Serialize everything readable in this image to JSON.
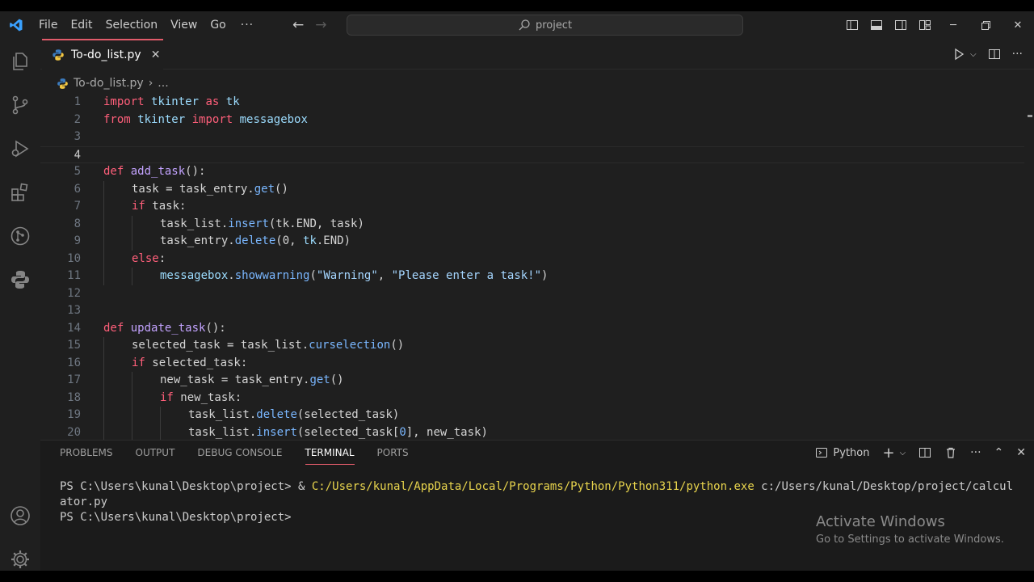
{
  "titlebar": {
    "menu": [
      "File",
      "Edit",
      "Selection",
      "View",
      "Go"
    ],
    "more": "···",
    "search_text": "project"
  },
  "activitybar": {
    "items": [
      "explorer-icon",
      "source-control-icon",
      "run-debug-icon",
      "extensions-icon",
      "git-graph-icon",
      "python-icon"
    ],
    "bottom": [
      "account-icon",
      "manage-gear-icon"
    ]
  },
  "editor": {
    "tab_label": "To-do_list.py",
    "breadcrumb_file": "To-do_list.py",
    "breadcrumb_more": "...",
    "active_line": 4,
    "lines": [
      {
        "n": "1",
        "indent": 0,
        "tokens": [
          [
            "kw",
            "import"
          ],
          [
            "pl",
            " "
          ],
          [
            "id",
            "tkinter"
          ],
          [
            "pl",
            " "
          ],
          [
            "kw",
            "as"
          ],
          [
            "pl",
            " "
          ],
          [
            "id",
            "tk"
          ]
        ]
      },
      {
        "n": "2",
        "indent": 0,
        "tokens": [
          [
            "kw",
            "from"
          ],
          [
            "pl",
            " "
          ],
          [
            "id",
            "tkinter"
          ],
          [
            "pl",
            " "
          ],
          [
            "kw",
            "import"
          ],
          [
            "pl",
            " "
          ],
          [
            "id",
            "messagebox"
          ]
        ]
      },
      {
        "n": "3",
        "indent": 0,
        "tokens": []
      },
      {
        "n": "4",
        "indent": 0,
        "tokens": []
      },
      {
        "n": "5",
        "indent": 0,
        "tokens": [
          [
            "kw",
            "def"
          ],
          [
            "pl",
            " "
          ],
          [
            "fn",
            "add_task"
          ],
          [
            "pl",
            "():"
          ]
        ]
      },
      {
        "n": "6",
        "indent": 1,
        "tokens": [
          [
            "pl",
            "task = task_entry."
          ],
          [
            "mt",
            "get"
          ],
          [
            "pl",
            "()"
          ]
        ]
      },
      {
        "n": "7",
        "indent": 1,
        "tokens": [
          [
            "kw",
            "if"
          ],
          [
            "pl",
            " task:"
          ]
        ]
      },
      {
        "n": "8",
        "indent": 2,
        "tokens": [
          [
            "pl",
            "task_list."
          ],
          [
            "mt",
            "insert"
          ],
          [
            "pl",
            "(tk.END, task)"
          ]
        ]
      },
      {
        "n": "9",
        "indent": 2,
        "tokens": [
          [
            "pl",
            "task_entry."
          ],
          [
            "mt",
            "delete"
          ],
          [
            "pl",
            "(0, "
          ],
          [
            "id",
            "tk"
          ],
          [
            "pl",
            ".END)"
          ]
        ]
      },
      {
        "n": "10",
        "indent": 1,
        "tokens": [
          [
            "kw",
            "else"
          ],
          [
            "pl",
            ":"
          ]
        ]
      },
      {
        "n": "11",
        "indent": 2,
        "tokens": [
          [
            "id",
            "messagebox"
          ],
          [
            "pl",
            "."
          ],
          [
            "mt",
            "showwarning"
          ],
          [
            "pl",
            "("
          ],
          [
            "str",
            "\"Warning\""
          ],
          [
            "pl",
            ", "
          ],
          [
            "str",
            "\"Please enter a task!\""
          ],
          [
            "pl",
            ")"
          ]
        ]
      },
      {
        "n": "12",
        "indent": 0,
        "tokens": []
      },
      {
        "n": "13",
        "indent": 0,
        "tokens": []
      },
      {
        "n": "14",
        "indent": 0,
        "tokens": [
          [
            "kw",
            "def"
          ],
          [
            "pl",
            " "
          ],
          [
            "fn",
            "update_task"
          ],
          [
            "pl",
            "():"
          ]
        ]
      },
      {
        "n": "15",
        "indent": 1,
        "tokens": [
          [
            "pl",
            "selected_task = task_list."
          ],
          [
            "mt",
            "curselection"
          ],
          [
            "pl",
            "()"
          ]
        ]
      },
      {
        "n": "16",
        "indent": 1,
        "tokens": [
          [
            "kw",
            "if"
          ],
          [
            "pl",
            " selected_task:"
          ]
        ]
      },
      {
        "n": "17",
        "indent": 2,
        "tokens": [
          [
            "pl",
            "new_task = task_entry."
          ],
          [
            "mt",
            "get"
          ],
          [
            "pl",
            "()"
          ]
        ]
      },
      {
        "n": "18",
        "indent": 2,
        "tokens": [
          [
            "kw",
            "if"
          ],
          [
            "pl",
            " new_task:"
          ]
        ]
      },
      {
        "n": "19",
        "indent": 3,
        "tokens": [
          [
            "pl",
            "task_list."
          ],
          [
            "mt",
            "delete"
          ],
          [
            "pl",
            "(selected_task)"
          ]
        ]
      },
      {
        "n": "20",
        "indent": 3,
        "tokens": [
          [
            "pl",
            "task_list."
          ],
          [
            "mt",
            "insert"
          ],
          [
            "pl",
            "(selected_task["
          ],
          [
            "mt",
            "0"
          ],
          [
            "pl",
            "], new_task)"
          ]
        ]
      }
    ]
  },
  "panel": {
    "tabs": [
      "PROBLEMS",
      "OUTPUT",
      "DEBUG CONSOLE",
      "TERMINAL",
      "PORTS"
    ],
    "active_tab": "TERMINAL",
    "profile": "Python",
    "terminal": {
      "line1_prompt": "PS C:\\Users\\kunal\\Desktop\\project> & ",
      "line1_exe": "C:/Users/kunal/AppData/Local/Programs/Python/Python311/python.exe",
      "line1_arg": " c:/Users/kunal/Desktop/project/calcul",
      "line2": "ator.py",
      "line3": "PS C:\\Users\\kunal\\Desktop\\project>"
    }
  },
  "watermark": {
    "title": "Activate Windows",
    "subtitle": "Go to Settings to activate Windows."
  },
  "colors": {
    "accent": "#e05b6a",
    "keyword": "#ff5f7a",
    "function": "#c3a3ff",
    "method": "#7ab7ff",
    "string": "#a5d6ff",
    "exe_path": "#e8d44d"
  }
}
